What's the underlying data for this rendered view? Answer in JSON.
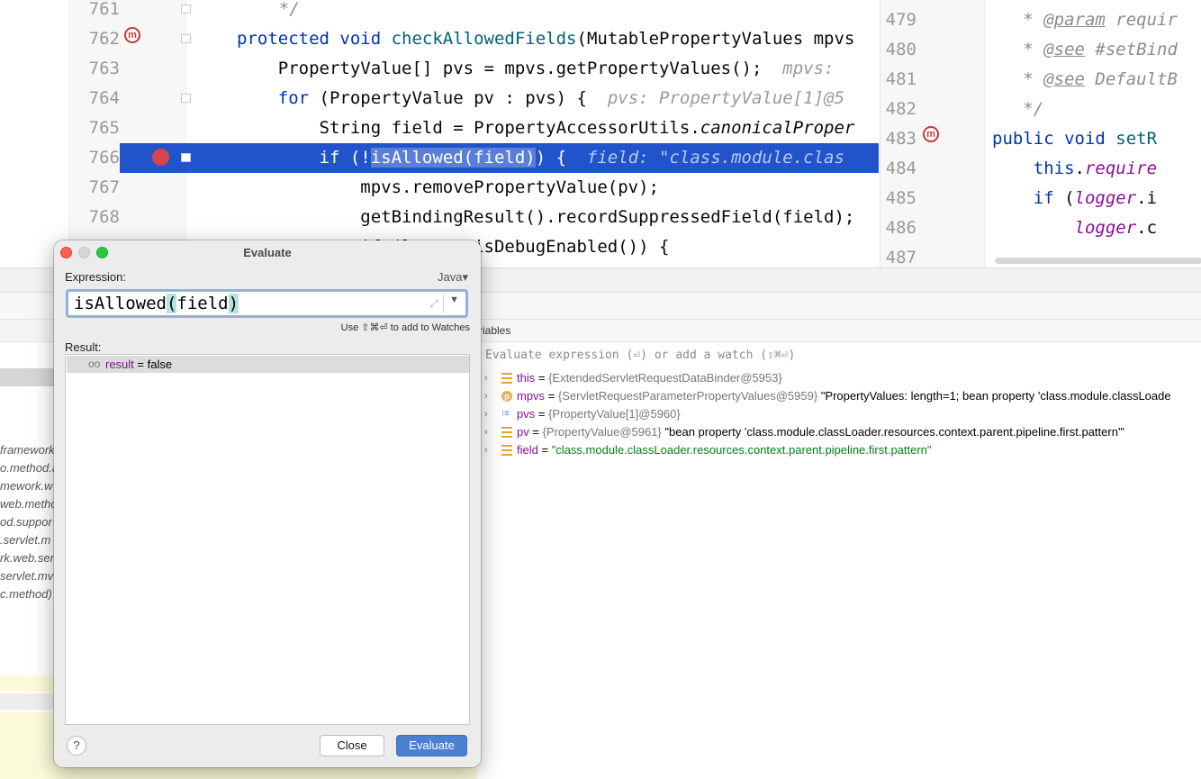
{
  "editor_left": {
    "lines": [
      {
        "num": "761",
        "pre": "",
        "parts": [
          {
            "t": "    */",
            "c": "cmt"
          }
        ]
      },
      {
        "num": "762",
        "parts": [
          {
            "t": "protected void ",
            "c": "kw"
          },
          {
            "t": "checkAllowedFields",
            "c": "fn"
          },
          {
            "t": "(MutablePropertyValues mpvs",
            "c": ""
          }
        ]
      },
      {
        "num": "763",
        "parts": [
          {
            "t": "    PropertyValue[] pvs = mpvs.getPropertyValues();  ",
            "c": ""
          },
          {
            "t": "mpvs: ",
            "c": "hint"
          }
        ]
      },
      {
        "num": "764",
        "parts": [
          {
            "t": "    ",
            "c": ""
          },
          {
            "t": "for",
            "c": "kw"
          },
          {
            "t": " (PropertyValue pv : pvs) {  ",
            "c": ""
          },
          {
            "t": "pvs: PropertyValue[1]@5",
            "c": "hint"
          }
        ]
      },
      {
        "num": "765",
        "parts": [
          {
            "t": "        String field = PropertyAccessorUtils.",
            "c": ""
          },
          {
            "t": "canonicalProper",
            "c": "it"
          }
        ]
      },
      {
        "num": "766",
        "parts": [
          {
            "t": "        if (!",
            "c": ""
          },
          {
            "t": "isAllowed(field)",
            "c": "sel"
          },
          {
            "t": ") {  ",
            "c": ""
          },
          {
            "t": "field: \"class.module.clas",
            "c": "hint"
          }
        ]
      },
      {
        "num": "767",
        "parts": [
          {
            "t": "            mpvs.removePropertyValue(pv);",
            "c": ""
          }
        ]
      },
      {
        "num": "768",
        "parts": [
          {
            "t": "            getBindingResult().recordSuppressedField(field);",
            "c": ""
          }
        ]
      },
      {
        "num": "",
        "parts": [
          {
            "t": "            if (logger.isDebugEnabled()) {",
            "c": ""
          }
        ]
      }
    ]
  },
  "editor_right": {
    "lines": [
      {
        "num": "479",
        "parts": [
          {
            "t": "   * ",
            "c": "cmt"
          },
          {
            "t": "@param",
            "c": "doc-tag"
          },
          {
            "t": " requir",
            "c": "cmt"
          }
        ]
      },
      {
        "num": "480",
        "parts": [
          {
            "t": "   * ",
            "c": "cmt"
          },
          {
            "t": "@see",
            "c": "doc-tag"
          },
          {
            "t": " #setBind",
            "c": "cmt"
          }
        ]
      },
      {
        "num": "481",
        "parts": [
          {
            "t": "   * ",
            "c": "cmt"
          },
          {
            "t": "@see",
            "c": "doc-tag"
          },
          {
            "t": " DefaultB",
            "c": "cmt"
          }
        ]
      },
      {
        "num": "482",
        "parts": [
          {
            "t": "   */",
            "c": "cmt"
          }
        ]
      },
      {
        "num": "483",
        "parts": [
          {
            "t": "public void ",
            "c": "kw"
          },
          {
            "t": "setR",
            "c": "fn"
          }
        ]
      },
      {
        "num": "484",
        "parts": [
          {
            "t": "    this",
            "c": "kw"
          },
          {
            "t": ".",
            "c": ""
          },
          {
            "t": "require",
            "c": "purple"
          }
        ]
      },
      {
        "num": "485",
        "parts": [
          {
            "t": "    if",
            "c": "kw"
          },
          {
            "t": " (",
            "c": ""
          },
          {
            "t": "logger",
            "c": "purple"
          },
          {
            "t": ".i",
            "c": ""
          }
        ]
      },
      {
        "num": "486",
        "parts": [
          {
            "t": "        ",
            "c": ""
          },
          {
            "t": "logger",
            "c": "purple"
          },
          {
            "t": ".c",
            "c": ""
          }
        ]
      },
      {
        "num": "487",
        "parts": []
      }
    ]
  },
  "frames": {
    "items": [
      "framework",
      "o.method.a",
      "mework.w",
      "web.metho",
      "od.suppor",
      ".servlet.m",
      "rk.web.ser",
      "servlet.mv",
      "c.method)"
    ]
  },
  "variables": {
    "tab_label": "riables",
    "watch_placeholder": "Evaluate expression (⏎) or add a watch (⇧⌘⏎)",
    "rows": [
      {
        "icon": "field",
        "name": "this",
        "type": "{ExtendedServletRequestDataBinder@5953}",
        "value": ""
      },
      {
        "icon": "p",
        "name": "mpvs",
        "type": "{ServletRequestParameterPropertyValues@5959}",
        "value": "\"PropertyValues: length=1; bean property 'class.module.classLoade"
      },
      {
        "icon": "array",
        "name": "pvs",
        "type": "{PropertyValue[1]@5960}",
        "value": ""
      },
      {
        "icon": "field",
        "name": "pv",
        "type": "{PropertyValue@5961}",
        "value": "\"bean property 'class.module.classLoader.resources.context.parent.pipeline.first.pattern'\""
      },
      {
        "icon": "field",
        "name": "field",
        "type": "",
        "value": "\"class.module.classLoader.resources.context.parent.pipeline.first.pattern\""
      }
    ]
  },
  "dialog": {
    "title": "Evaluate",
    "expression_label": "Expression:",
    "language": "Java",
    "expression": {
      "fn": "isAllowed",
      "lp": "(",
      "arg": "field",
      "rp": ")"
    },
    "watch_hint": "Use ⇧⌘⏎ to add to Watches",
    "result_label": "Result:",
    "result": {
      "name": "result",
      "eq": " = ",
      "value": "false"
    },
    "help_label": "?",
    "close_label": "Close",
    "evaluate_label": "Evaluate"
  }
}
